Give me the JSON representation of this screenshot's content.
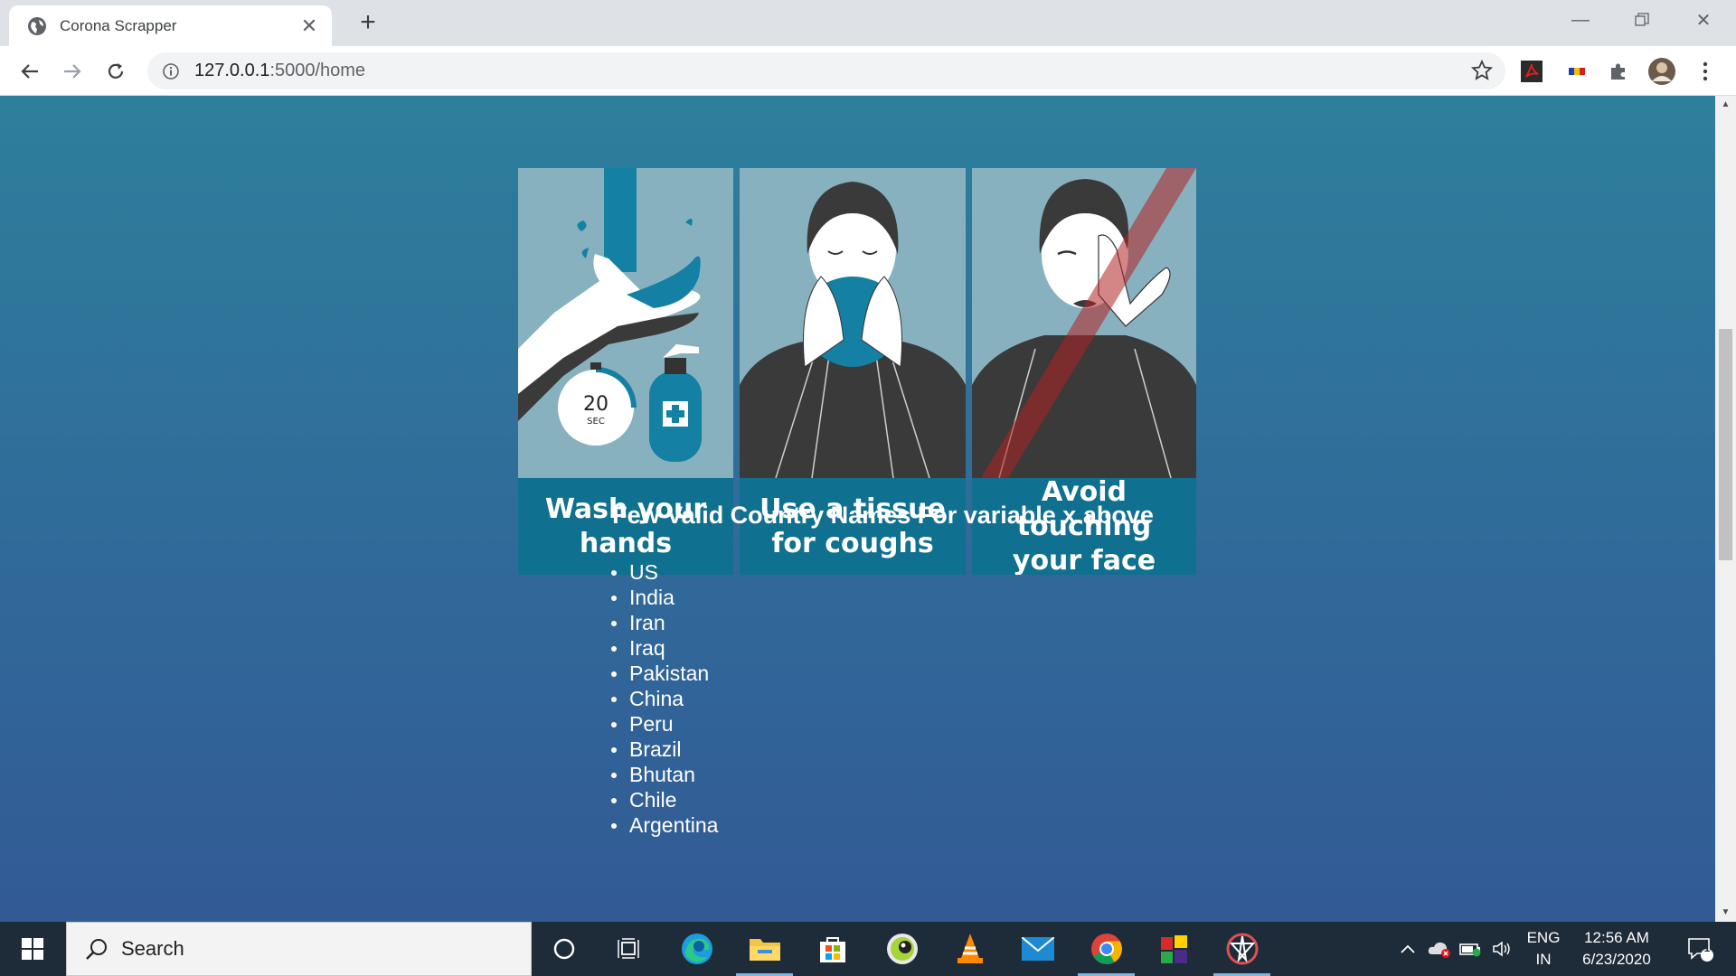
{
  "browser": {
    "tab_title": "Corona Scrapper",
    "url_host": "127.0.0.1",
    "url_path": ":5000/home"
  },
  "poster": {
    "panels": [
      {
        "caption_line1": "Wash your",
        "caption_line2": "hands"
      },
      {
        "caption_line1": "Use a tissue",
        "caption_line2": "for coughs"
      },
      {
        "caption_line1": "Avoid touching",
        "caption_line2": "your face"
      }
    ],
    "timer_value": "20",
    "timer_unit": "SEC"
  },
  "page": {
    "heading": "Few Valid Country Names For variable x above",
    "countries": [
      "US",
      "India",
      "Iran",
      "Iraq",
      "Pakistan",
      "China",
      "Peru",
      "Brazil",
      "Bhutan",
      "Chile",
      "Argentina"
    ]
  },
  "taskbar": {
    "search_placeholder": "Search",
    "lang_line1": "ENG",
    "lang_line2": "IN",
    "time": "12:56 AM",
    "date": "6/23/2020",
    "notification_count": "1"
  },
  "colors": {
    "page_bg_top": "#2e7f9c",
    "page_bg_bottom": "#325a95",
    "caption_bg": "#10708f",
    "art_bg": "#88b1bf"
  }
}
